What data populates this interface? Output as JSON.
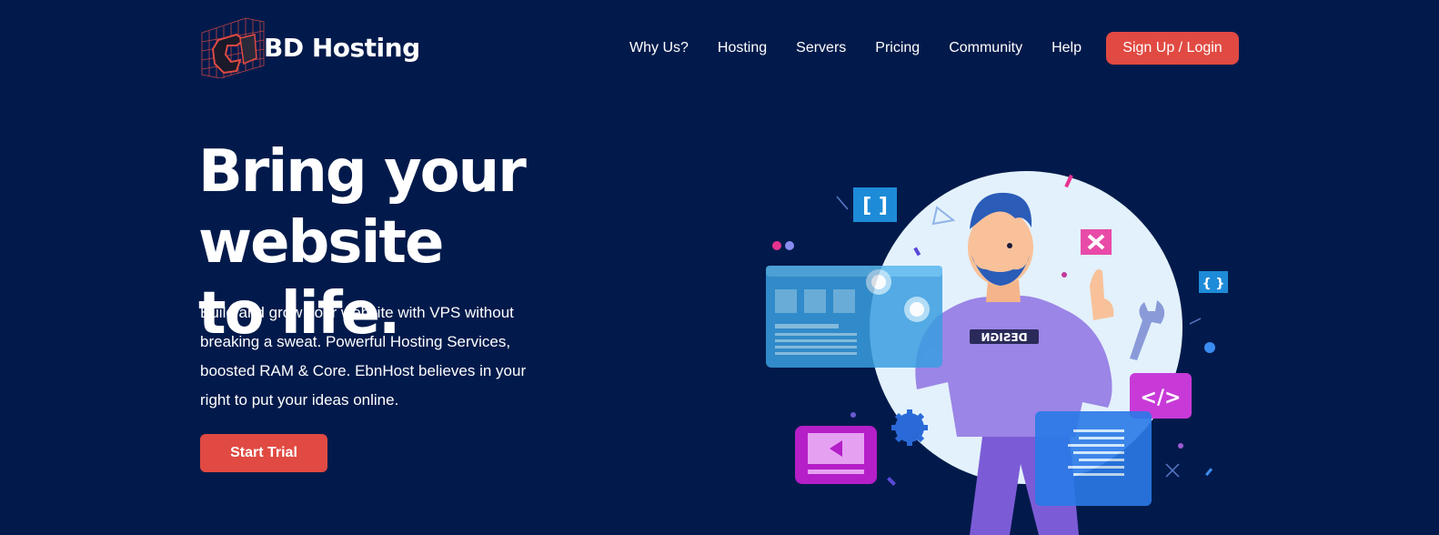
{
  "brand": {
    "name": "BD Hosting",
    "accent_color": "#e04a42",
    "background_color": "#021a4b"
  },
  "nav": {
    "items": [
      {
        "label": "Why Us?"
      },
      {
        "label": "Hosting"
      },
      {
        "label": "Servers"
      },
      {
        "label": "Pricing"
      },
      {
        "label": "Community"
      },
      {
        "label": "Help"
      }
    ],
    "cta_label": "Sign Up / Login"
  },
  "hero": {
    "title_line1": "Bring your website",
    "title_line2": "to life.",
    "description": "Build and grow your website with VPS without breaking a sweat. Powerful Hosting Services, boosted RAM & Core. EbnHost believes in your right to put your ideas online.",
    "cta_label": "Start Trial"
  },
  "illustration": {
    "shirt_text": "DESIGN",
    "icons": [
      "brackets-icon",
      "code-icon",
      "close-icon",
      "play-icon",
      "wrench-icon",
      "gear-icon",
      "document-icon"
    ]
  }
}
